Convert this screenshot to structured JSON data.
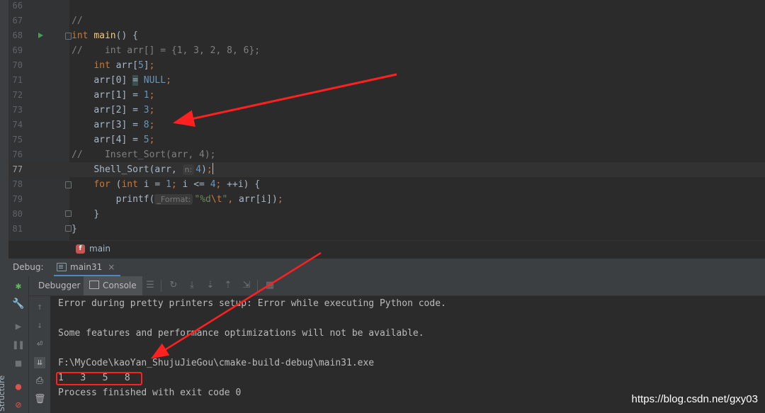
{
  "sidebar": {
    "structure_label": "Structure"
  },
  "editor": {
    "line_numbers": [
      "66",
      "67",
      "68",
      "69",
      "70",
      "71",
      "72",
      "73",
      "74",
      "75",
      "76",
      "77",
      "78",
      "79",
      "80",
      "81"
    ],
    "l67": {
      "comment": "//"
    },
    "l68": {
      "kw_int": "int",
      "fn_main": "main",
      "rest": "() {"
    },
    "l69": {
      "comment": "//    int arr[] = {1, 3, 2, 8, 6};"
    },
    "l70": {
      "kw_int": "int",
      "name": " arr[",
      "n": "5",
      "close": "]",
      "semi": ";"
    },
    "l71": {
      "lhs": "arr[0] ",
      "eq": "=",
      "sp": " ",
      "null": "NULL",
      "semi": ";"
    },
    "l72": {
      "lhs": "arr[1] = ",
      "v": "1",
      "semi": ";"
    },
    "l73": {
      "lhs": "arr[2] = ",
      "v": "3",
      "semi": ";"
    },
    "l74": {
      "lhs": "arr[3] = ",
      "v": "8",
      "semi": ";"
    },
    "l75": {
      "lhs": "arr[4] = ",
      "v": "5",
      "semi": ";"
    },
    "l76": {
      "comment": "//    Insert_Sort(arr, 4);"
    },
    "l77": {
      "call": "Shell_Sort(arr, ",
      "hint": "n:",
      "v": "4",
      "close": ")",
      "semi": ";"
    },
    "l78": {
      "kw_for": "for",
      "p1": " (",
      "kw_int": "int",
      "p2": " i = ",
      "v1": "1",
      "s1": ";",
      "p3": " i <= ",
      "v2": "4",
      "s2": ";",
      "p4": " ++i) {"
    },
    "l79": {
      "call": "printf(",
      "hint": "_Format:",
      "str_a": "\"%d",
      "esc": "\\t",
      "str_b": "\"",
      "comma": ",",
      "rest": " arr[i])",
      "semi": ";"
    },
    "l80": {
      "brace": "}"
    },
    "l81": {
      "brace": "}"
    }
  },
  "breadcrumb": {
    "icon": "f",
    "label": "main"
  },
  "debug": {
    "title": "Debug:",
    "tab_label": "main31",
    "tab_close": "×",
    "tabs": {
      "debugger": "Debugger",
      "console": "Console"
    }
  },
  "console": {
    "lines": [
      "Error during pretty printers setup: Error while executing Python code.",
      "Some features and performance optimizations will not be available.",
      "F:\\MyCode\\kaoYan_ShujuJieGou\\cmake-build-debug\\main31.exe",
      "1\t3\t5\t8",
      "Process finished with exit code 0"
    ]
  },
  "watermark": "https://blog.csdn.net/gxy03",
  "colors": {
    "keyword": "#cc7832",
    "number": "#6897bb",
    "string": "#6a8759",
    "function": "#ffc66d",
    "annotation": "#ff2020"
  }
}
